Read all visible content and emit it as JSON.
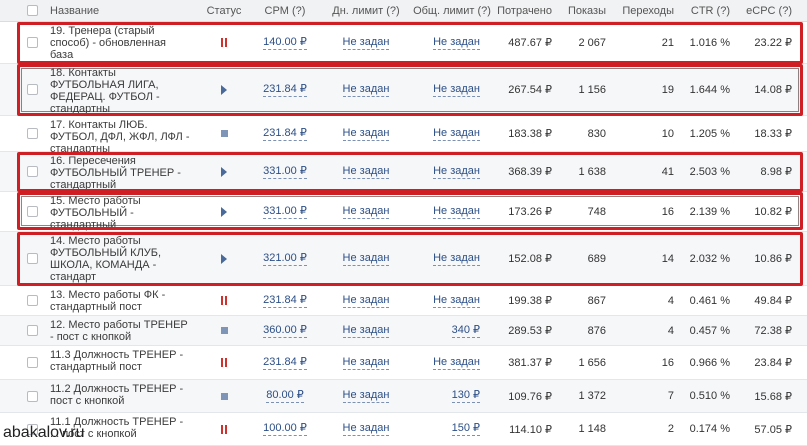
{
  "header": {
    "name": "Название",
    "status": "Статус",
    "cpm": "CPM (?)",
    "daily_limit": "Дн. лимит (?)",
    "total_limit": "Общ. лимит (?)",
    "spent": "Потрачено",
    "impressions": "Показы",
    "clicks": "Переходы",
    "ctr": "CTR (?)",
    "ecpc": "eCPC (?)"
  },
  "rows": [
    {
      "name": "19. Тренера (старый способ) - обновленная база",
      "status": "pause",
      "cpm": "140.00 ₽",
      "daily": "Не задан",
      "total": "Не задан",
      "spent": "487.67 ₽",
      "impr": "2 067",
      "clicks": "21",
      "ctr": "1.016 %",
      "ecpc": "23.22 ₽"
    },
    {
      "name": "18. Контакты ФУТБОЛЬНАЯ ЛИГА, ФЕДЕРАЦ. ФУТБОЛ - стандартны",
      "status": "play",
      "cpm": "231.84 ₽",
      "daily": "Не задан",
      "total": "Не задан",
      "spent": "267.54 ₽",
      "impr": "1 156",
      "clicks": "19",
      "ctr": "1.644 %",
      "ecpc": "14.08 ₽"
    },
    {
      "name": "17. Контакты ЛЮБ. ФУТБОЛ, ДФЛ, ЖФЛ, ЛФЛ - стандартны",
      "status": "stop",
      "cpm": "231.84 ₽",
      "daily": "Не задан",
      "total": "Не задан",
      "spent": "183.38 ₽",
      "impr": "830",
      "clicks": "10",
      "ctr": "1.205 %",
      "ecpc": "18.33 ₽"
    },
    {
      "name": "16. Пересечения ФУТБОЛЬНЫЙ ТРЕНЕР - стандартный",
      "status": "play",
      "cpm": "331.00 ₽",
      "daily": "Не задан",
      "total": "Не задан",
      "spent": "368.39 ₽",
      "impr": "1 638",
      "clicks": "41",
      "ctr": "2.503 %",
      "ecpc": "8.98 ₽"
    },
    {
      "name": "15. Место работы ФУТБОЛЬНЫЙ - стандартный",
      "status": "play",
      "cpm": "331.00 ₽",
      "daily": "Не задан",
      "total": "Не задан",
      "spent": "173.26 ₽",
      "impr": "748",
      "clicks": "16",
      "ctr": "2.139 %",
      "ecpc": "10.82 ₽"
    },
    {
      "name": "14. Место работы ФУТБОЛЬНЫЙ КЛУБ, ШКОЛА, КОМАНДА - стандарт",
      "status": "play",
      "cpm": "321.00 ₽",
      "daily": "Не задан",
      "total": "Не задан",
      "spent": "152.08 ₽",
      "impr": "689",
      "clicks": "14",
      "ctr": "2.032 %",
      "ecpc": "10.86 ₽"
    },
    {
      "name": "13. Место работы ФК - стандартный пост",
      "status": "pause",
      "cpm": "231.84 ₽",
      "daily": "Не задан",
      "total": "Не задан",
      "spent": "199.38 ₽",
      "impr": "867",
      "clicks": "4",
      "ctr": "0.461 %",
      "ecpc": "49.84 ₽"
    },
    {
      "name": "12. Место работы ТРЕНЕР - пост с кнопкой",
      "status": "stop",
      "cpm": "360.00 ₽",
      "daily": "Не задан",
      "total": "340 ₽",
      "spent": "289.53 ₽",
      "impr": "876",
      "clicks": "4",
      "ctr": "0.457 %",
      "ecpc": "72.38 ₽"
    },
    {
      "name": "11.3 Должность ТРЕНЕР - стандартный пост",
      "status": "pause",
      "cpm": "231.84 ₽",
      "daily": "Не задан",
      "total": "Не задан",
      "spent": "381.37 ₽",
      "impr": "1 656",
      "clicks": "16",
      "ctr": "0.966 %",
      "ecpc": "23.84 ₽"
    },
    {
      "name": "11.2 Должность ТРЕНЕР - пост с кнопкой",
      "status": "stop",
      "cpm": "80.00 ₽",
      "daily": "Не задан",
      "total": "130 ₽",
      "spent": "109.76 ₽",
      "impr": "1 372",
      "clicks": "7",
      "ctr": "0.510 %",
      "ecpc": "15.68 ₽"
    },
    {
      "name": "11.1 Должность ТРЕНЕР - ... пост с кнопкой",
      "status": "pause",
      "cpm": "100.00 ₽",
      "daily": "Не задан",
      "total": "150 ₽",
      "spent": "114.10 ₽",
      "impr": "1 148",
      "clicks": "2",
      "ctr": "0.174 %",
      "ecpc": "57.05 ₽"
    }
  ],
  "watermark": "abakalov.ru"
}
